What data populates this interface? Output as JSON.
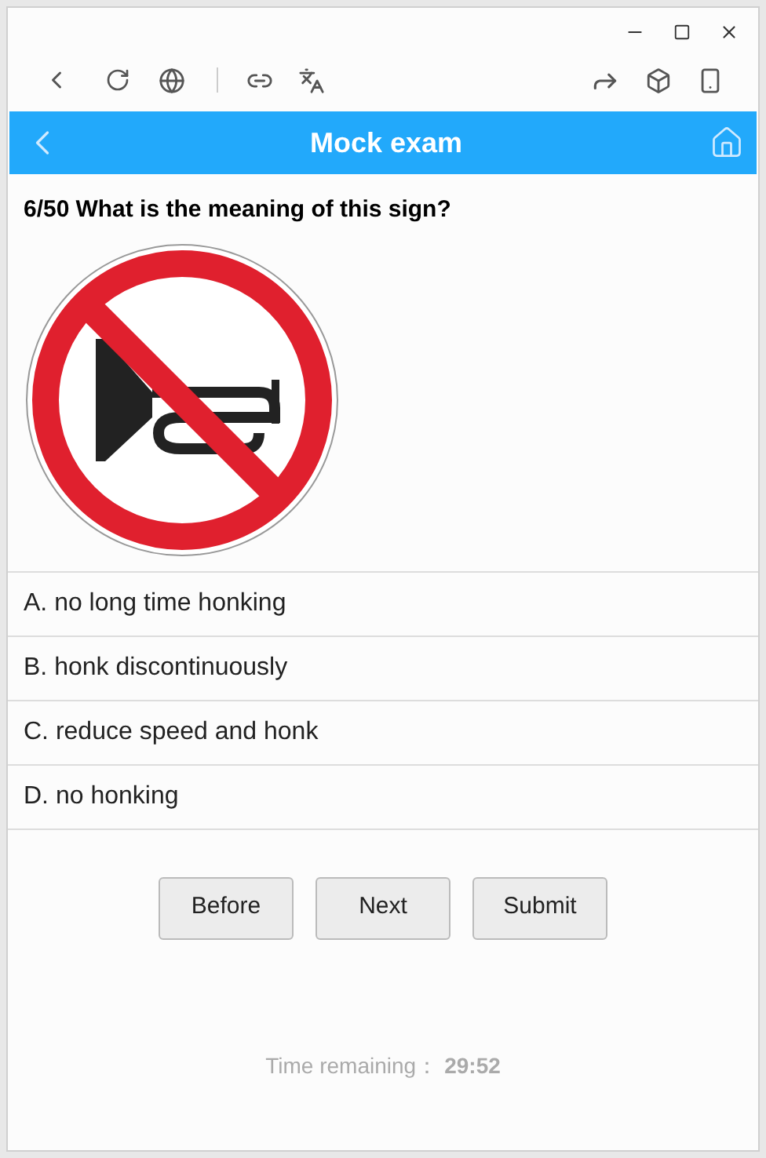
{
  "header": {
    "title": "Mock exam"
  },
  "question": {
    "number": "6/50",
    "text": "What is the meaning of this sign?"
  },
  "options": [
    {
      "label": "A. no long time honking"
    },
    {
      "label": "B. honk discontinuously"
    },
    {
      "label": "C. reduce speed and honk"
    },
    {
      "label": "D. no honking"
    }
  ],
  "buttons": [
    "Before",
    "Next",
    "Submit"
  ],
  "timer": {
    "label": "Time remaining：",
    "value": "29:52"
  }
}
